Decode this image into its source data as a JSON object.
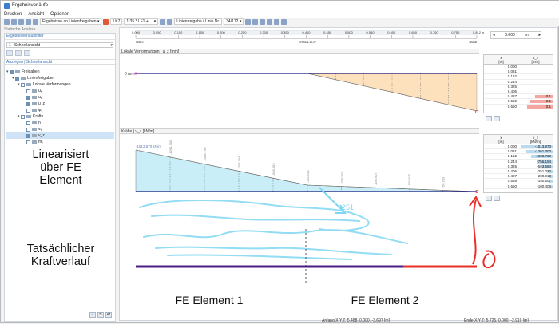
{
  "window": {
    "title": "Ergebnisverläufe"
  },
  "menu": [
    "Drucken",
    "Ansicht",
    "Optionen"
  ],
  "toolbar": {
    "results_combo": "Ergebnisse an Linienfreigaben",
    "lk_badge": "LK7",
    "lk_combo": "1.35 * LF1 + ...",
    "release_combo": "Linienfreigabe / Linie Nr.",
    "release_value": "34/172",
    "subtitle": "Statische Analyse"
  },
  "navigator": {
    "header": "Ergebnisverlaufsfilter",
    "quickview_num": "1",
    "quickview_label": "Schnellansicht",
    "display_header": "Anzeigen | Schnellansicht",
    "tree": [
      {
        "label": "Freigaben",
        "level": 0,
        "checked": true,
        "expand": "▾"
      },
      {
        "label": "Linienfreigaben",
        "level": 1,
        "checked": true,
        "expand": "▾"
      },
      {
        "label": "Lokale Verformungen",
        "level": 2,
        "checked": false,
        "expand": "▾"
      },
      {
        "label": "uₓ",
        "level": 3,
        "checked": false,
        "expand": ""
      },
      {
        "label": "uᵧ",
        "level": 3,
        "checked": true,
        "expand": ""
      },
      {
        "label": "u_z",
        "level": 3,
        "checked": true,
        "expand": ""
      },
      {
        "label": "φₓ",
        "level": 3,
        "checked": false,
        "expand": ""
      },
      {
        "label": "Kräfte",
        "level": 2,
        "checked": false,
        "expand": "▾"
      },
      {
        "label": "n",
        "level": 3,
        "checked": false,
        "expand": ""
      },
      {
        "label": "vᵧ",
        "level": 3,
        "checked": false,
        "expand": ""
      },
      {
        "label": "v_z",
        "level": 3,
        "checked": true,
        "expand": "",
        "selected": true
      },
      {
        "label": "mₓ",
        "level": 3,
        "checked": false,
        "expand": ""
      }
    ]
  },
  "annotations": {
    "left_top": "Linearisiert\nüber FE\nElement",
    "left_bottom": "Tatsächlicher\nKraftverlauf",
    "fe1": "FE Element 1",
    "fe2": "FE Element 2",
    "scribble": "-251"
  },
  "ruler": {
    "ticks": [
      "0.000",
      "0.050",
      "0.100",
      "0.150",
      "0.200",
      "0.250",
      "0.300",
      "0.350",
      "0.400",
      "0.450",
      "0.500",
      "0.550",
      "0.600",
      "0.650",
      "0.700",
      "0.750",
      "0.812"
    ],
    "unit": "m",
    "start_node": "N462",
    "end_node": "N688",
    "mid_label": "<R34/L172>"
  },
  "station": {
    "value": "0.000",
    "unit": "m"
  },
  "deformation": {
    "header": "Lokale Verformungen | u_z [mm]",
    "zero_label": "0 mm",
    "table_head": [
      "x\n[m]",
      "u_z\n[mm]"
    ],
    "rows": [
      [
        "0.000",
        ""
      ],
      [
        "0.081",
        ""
      ],
      [
        "0.162",
        ""
      ],
      [
        "0.244",
        ""
      ],
      [
        "0.325",
        ""
      ],
      [
        "0.406",
        ""
      ],
      [
        "0.487",
        "0.1"
      ],
      [
        "0.569",
        "0.1"
      ],
      [
        "0.650",
        "0.1"
      ]
    ],
    "bar_fracs": [
      0,
      0,
      0,
      0,
      0,
      0,
      0.55,
      0.7,
      0.8
    ]
  },
  "forces": {
    "header": "Kräfte | v_z [kN/m]",
    "first_label": "-1513.870 kN/m",
    "value_labels": [
      "-1513.870",
      "-1261.300",
      "-1008.730",
      "-756.154",
      "-503.583",
      "-251.012",
      "-200.910",
      "-150.607",
      "-100.405",
      "-50.203"
    ],
    "table_head": [
      "x\n[m]",
      "v_z\n[kN/m]"
    ],
    "rows": [
      [
        "0.000",
        "-1513.870"
      ],
      [
        "0.081",
        "-1261.300"
      ],
      [
        "0.162",
        "-1008.730"
      ],
      [
        "0.244",
        "-756.154"
      ],
      [
        "0.325",
        "-503.583"
      ],
      [
        "0.406",
        "-251.012"
      ],
      [
        "0.487",
        "-200.910"
      ],
      [
        "0.569",
        "-150.607"
      ],
      [
        "0.650",
        "-100.405"
      ]
    ],
    "bar_fracs": [
      1,
      0.83,
      0.67,
      0.5,
      0.33,
      0.17,
      0.13,
      0.1,
      0.07
    ]
  },
  "status": {
    "start": "Anfang X,Y,Z: 5.488, 0.000, -3.697 [m]",
    "end": "Ende X,Y,Z: 5.725, 0.000, -2.919 [m]"
  },
  "colors": {
    "accent": "#2f6fb0",
    "deform_fill": "#fde1bd",
    "force_fill": "#c9eef7",
    "member_line": "#1a1a80",
    "red": "#e8302a"
  }
}
